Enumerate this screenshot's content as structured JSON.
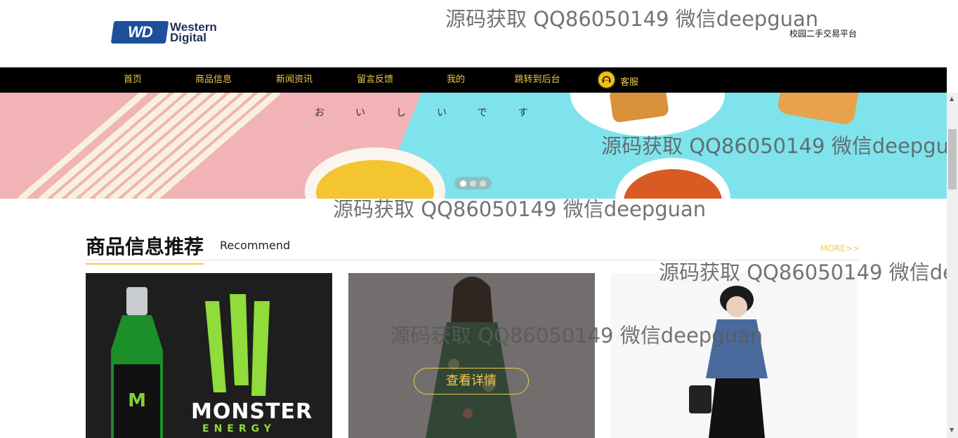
{
  "header": {
    "logo_line1": "Western",
    "logo_line2": "Digital",
    "logo_badge": "WD",
    "site_name": "校园二手交易平台"
  },
  "nav": {
    "items": [
      "首页",
      "商品信息",
      "新闻资讯",
      "留言反馈",
      "我的",
      "跳转到后台",
      "客服"
    ]
  },
  "banner": {
    "text": "おいしいです",
    "active_slide": 1,
    "slide_count": 3
  },
  "section": {
    "title": "商品信息推荐",
    "subtitle": "Recommend",
    "more_label": "MORE>>"
  },
  "products": [
    {
      "image": "monster-energy-bottle",
      "caption": "MONSTER",
      "caption2": "ENERGY"
    },
    {
      "image": "floral-dress-model",
      "detail_label": "查看详情"
    },
    {
      "image": "denim-jacket-model"
    }
  ],
  "watermark": "源码获取 QQ86050149 微信deepguan",
  "colors": {
    "accent": "#f2c94c",
    "nav_bg": "#000000",
    "logo_blue": "#1d4f9c"
  }
}
